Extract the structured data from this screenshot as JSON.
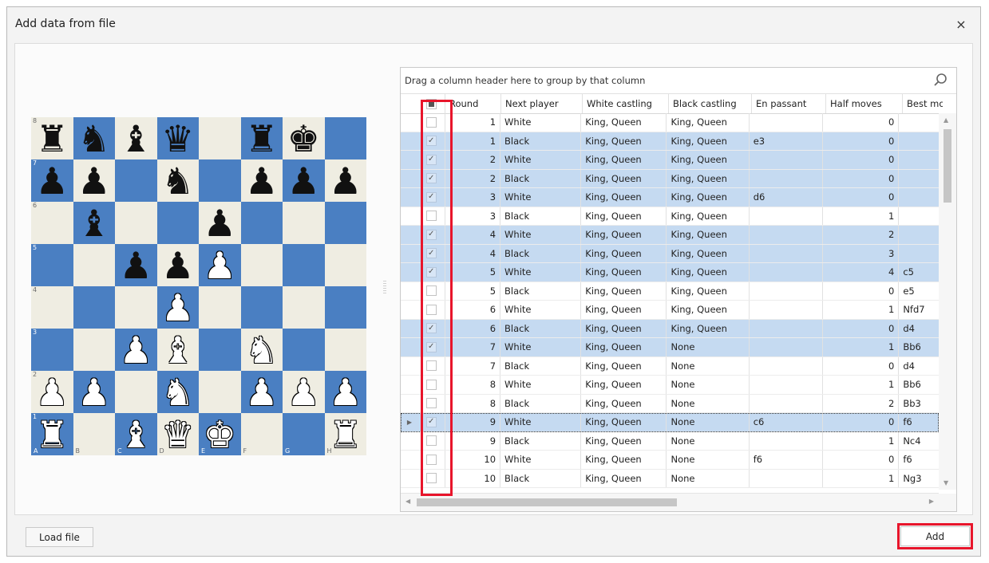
{
  "dialog": {
    "title": "Add data from file",
    "close_glyph": "×"
  },
  "board": {
    "ranks": [
      "8",
      "7",
      "6",
      "5",
      "4",
      "3",
      "2",
      "1"
    ],
    "files": [
      "A",
      "B",
      "C",
      "D",
      "E",
      "F",
      "G",
      "H"
    ],
    "position": [
      [
        "r",
        "n",
        "b",
        "q",
        "",
        "r",
        "k",
        ""
      ],
      [
        "p",
        "p",
        "",
        "n",
        "",
        "p",
        "p",
        "p"
      ],
      [
        "",
        "b",
        "",
        "",
        "p",
        "",
        "",
        ""
      ],
      [
        "",
        "",
        "p",
        "p",
        "P",
        "",
        "",
        ""
      ],
      [
        "",
        "",
        "",
        "P",
        "",
        "",
        "",
        ""
      ],
      [
        "",
        "",
        "P",
        "B",
        "",
        "N",
        "",
        ""
      ],
      [
        "P",
        "P",
        "",
        "N",
        "",
        "P",
        "P",
        "P"
      ],
      [
        "R",
        "",
        "B",
        "Q",
        "K",
        "",
        "",
        "R"
      ]
    ]
  },
  "grid": {
    "group_panel_text": "Drag a column header here to group by that column",
    "find_icon": "search-icon",
    "columns": [
      "Round",
      "Next player",
      "White castling",
      "Black castling",
      "En passant",
      "Half moves",
      "Best move"
    ],
    "rows": [
      {
        "checked": false,
        "round": "1",
        "next": "White",
        "wc": "King, Queen",
        "bc": "King, Queen",
        "ep": "",
        "hm": "0",
        "bm": ""
      },
      {
        "checked": true,
        "round": "1",
        "next": "Black",
        "wc": "King, Queen",
        "bc": "King, Queen",
        "ep": "e3",
        "hm": "0",
        "bm": ""
      },
      {
        "checked": true,
        "round": "2",
        "next": "White",
        "wc": "King, Queen",
        "bc": "King, Queen",
        "ep": "",
        "hm": "0",
        "bm": ""
      },
      {
        "checked": true,
        "round": "2",
        "next": "Black",
        "wc": "King, Queen",
        "bc": "King, Queen",
        "ep": "",
        "hm": "0",
        "bm": ""
      },
      {
        "checked": true,
        "round": "3",
        "next": "White",
        "wc": "King, Queen",
        "bc": "King, Queen",
        "ep": "d6",
        "hm": "0",
        "bm": ""
      },
      {
        "checked": false,
        "round": "3",
        "next": "Black",
        "wc": "King, Queen",
        "bc": "King, Queen",
        "ep": "",
        "hm": "1",
        "bm": ""
      },
      {
        "checked": true,
        "round": "4",
        "next": "White",
        "wc": "King, Queen",
        "bc": "King, Queen",
        "ep": "",
        "hm": "2",
        "bm": ""
      },
      {
        "checked": true,
        "round": "4",
        "next": "Black",
        "wc": "King, Queen",
        "bc": "King, Queen",
        "ep": "",
        "hm": "3",
        "bm": ""
      },
      {
        "checked": true,
        "round": "5",
        "next": "White",
        "wc": "King, Queen",
        "bc": "King, Queen",
        "ep": "",
        "hm": "4",
        "bm": "c5"
      },
      {
        "checked": false,
        "round": "5",
        "next": "Black",
        "wc": "King, Queen",
        "bc": "King, Queen",
        "ep": "",
        "hm": "0",
        "bm": "e5"
      },
      {
        "checked": false,
        "round": "6",
        "next": "White",
        "wc": "King, Queen",
        "bc": "King, Queen",
        "ep": "",
        "hm": "1",
        "bm": "Nfd7"
      },
      {
        "checked": true,
        "round": "6",
        "next": "Black",
        "wc": "King, Queen",
        "bc": "King, Queen",
        "ep": "",
        "hm": "0",
        "bm": "d4"
      },
      {
        "checked": true,
        "round": "7",
        "next": "White",
        "wc": "King, Queen",
        "bc": "None",
        "ep": "",
        "hm": "1",
        "bm": "Bb6"
      },
      {
        "checked": false,
        "round": "7",
        "next": "Black",
        "wc": "King, Queen",
        "bc": "None",
        "ep": "",
        "hm": "0",
        "bm": "d4"
      },
      {
        "checked": false,
        "round": "8",
        "next": "White",
        "wc": "King, Queen",
        "bc": "None",
        "ep": "",
        "hm": "1",
        "bm": "Bb6"
      },
      {
        "checked": false,
        "round": "8",
        "next": "Black",
        "wc": "King, Queen",
        "bc": "None",
        "ep": "",
        "hm": "2",
        "bm": "Bb3"
      },
      {
        "checked": true,
        "round": "9",
        "next": "White",
        "wc": "King, Queen",
        "bc": "None",
        "ep": "c6",
        "hm": "0",
        "bm": "f6",
        "focused": true
      },
      {
        "checked": false,
        "round": "9",
        "next": "Black",
        "wc": "King, Queen",
        "bc": "None",
        "ep": "",
        "hm": "1",
        "bm": "Nc4"
      },
      {
        "checked": false,
        "round": "10",
        "next": "White",
        "wc": "King, Queen",
        "bc": "None",
        "ep": "f6",
        "hm": "0",
        "bm": "f6"
      },
      {
        "checked": false,
        "round": "10",
        "next": "Black",
        "wc": "King, Queen",
        "bc": "None",
        "ep": "",
        "hm": "1",
        "bm": "Ng3"
      }
    ]
  },
  "buttons": {
    "load_file": "Load file",
    "add": "Add"
  },
  "colors": {
    "board_dark": "#4a7fc2",
    "board_light": "#efede2",
    "selected_row": "#c5daf1",
    "highlight": "#e8152b"
  }
}
